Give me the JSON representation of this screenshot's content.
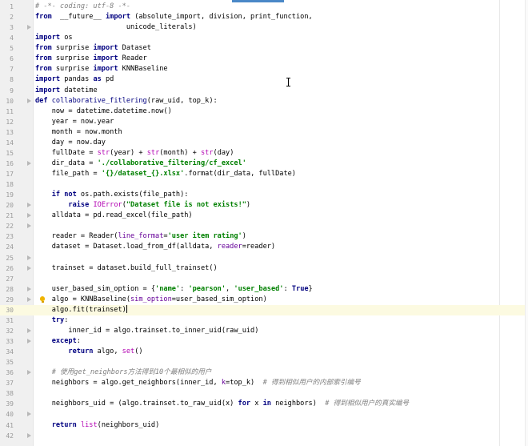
{
  "editor": {
    "language": "python",
    "current_line": 30,
    "lines": [
      {
        "n": "1",
        "t": [
          [
            "c",
            "# -*- coding: utf-8 -*-"
          ]
        ]
      },
      {
        "n": "2",
        "t": [
          [
            "k",
            "from"
          ],
          [
            "",
            "  __future__ "
          ],
          [
            "k",
            "import"
          ],
          [
            "",
            " (absolute_import, division, print_function,"
          ]
        ]
      },
      {
        "n": "3",
        "t": [
          [
            "",
            "                      unicode_literals)"
          ]
        ]
      },
      {
        "n": "4",
        "t": [
          [
            "k",
            "import"
          ],
          [
            "",
            " os"
          ]
        ]
      },
      {
        "n": "5",
        "t": [
          [
            "k",
            "from"
          ],
          [
            "",
            " surprise "
          ],
          [
            "k",
            "import"
          ],
          [
            "",
            " Dataset"
          ]
        ]
      },
      {
        "n": "6",
        "t": [
          [
            "k",
            "from"
          ],
          [
            "",
            " surprise "
          ],
          [
            "k",
            "import"
          ],
          [
            "",
            " Reader"
          ]
        ]
      },
      {
        "n": "7",
        "t": [
          [
            "k",
            "from"
          ],
          [
            "",
            " surprise "
          ],
          [
            "k",
            "import"
          ],
          [
            "",
            " KNNBaseline"
          ]
        ]
      },
      {
        "n": "8",
        "t": [
          [
            "k",
            "import"
          ],
          [
            "",
            " pandas "
          ],
          [
            "k",
            "as"
          ],
          [
            "",
            " pd"
          ]
        ]
      },
      {
        "n": "9",
        "t": [
          [
            "k",
            "import"
          ],
          [
            "",
            " datetime"
          ]
        ]
      },
      {
        "n": "10",
        "t": [
          [
            "k",
            "def"
          ],
          [
            "",
            " "
          ],
          [
            "f",
            "collaborative_fitlering"
          ],
          [
            "",
            "(raw_uid, top_k):"
          ]
        ]
      },
      {
        "n": "11",
        "t": [
          [
            "",
            "    now = datetime.datetime.now()"
          ]
        ]
      },
      {
        "n": "12",
        "t": [
          [
            "",
            "    year = now.year"
          ]
        ]
      },
      {
        "n": "13",
        "t": [
          [
            "",
            "    month = now.month"
          ]
        ]
      },
      {
        "n": "14",
        "t": [
          [
            "",
            "    day = now.day"
          ]
        ]
      },
      {
        "n": "15",
        "t": [
          [
            "",
            "    fullDate = "
          ],
          [
            "d",
            "str"
          ],
          [
            "",
            "(year) + "
          ],
          [
            "d",
            "str"
          ],
          [
            "",
            "(month) + "
          ],
          [
            "d",
            "str"
          ],
          [
            "",
            "(day)"
          ]
        ]
      },
      {
        "n": "16",
        "t": [
          [
            "",
            "    dir_data = "
          ],
          [
            "s",
            "'./collaborative_filtering/cf_excel'"
          ]
        ]
      },
      {
        "n": "17",
        "t": [
          [
            "",
            "    file_path = "
          ],
          [
            "s",
            "'{}/dataset_{}.xlsx'"
          ],
          [
            "",
            ".format(dir_data, fullDate)"
          ]
        ]
      },
      {
        "n": "18",
        "t": []
      },
      {
        "n": "19",
        "t": [
          [
            "",
            "    "
          ],
          [
            "k",
            "if not"
          ],
          [
            "",
            " os.path.exists(file_path):"
          ]
        ]
      },
      {
        "n": "20",
        "t": [
          [
            "",
            "        "
          ],
          [
            "k",
            "raise"
          ],
          [
            "",
            " "
          ],
          [
            "d",
            "IOError"
          ],
          [
            "",
            "("
          ],
          [
            "s",
            "\"Dataset file is not exists!\""
          ],
          [
            "",
            ")"
          ]
        ]
      },
      {
        "n": "21",
        "t": [
          [
            "",
            "    alldata = pd.read_excel(file_path)"
          ]
        ]
      },
      {
        "n": "22",
        "t": []
      },
      {
        "n": "23",
        "t": [
          [
            "",
            "    reader = Reader("
          ],
          [
            "p",
            "line_format"
          ],
          [
            "",
            "="
          ],
          [
            "s",
            "'user item rating'"
          ],
          [
            "",
            ")"
          ]
        ]
      },
      {
        "n": "24",
        "t": [
          [
            "",
            "    dataset = Dataset.load_from_df(alldata, "
          ],
          [
            "p",
            "reader"
          ],
          [
            "",
            "=reader)"
          ]
        ]
      },
      {
        "n": "25",
        "t": []
      },
      {
        "n": "26",
        "t": [
          [
            "",
            "    trainset = dataset.build_full_trainset()"
          ]
        ]
      },
      {
        "n": "27",
        "t": []
      },
      {
        "n": "28",
        "t": [
          [
            "",
            "    user_based_sim_option = {"
          ],
          [
            "s",
            "'name'"
          ],
          [
            "",
            ": "
          ],
          [
            "s",
            "'pearson'"
          ],
          [
            "",
            ", "
          ],
          [
            "s",
            "'user_based'"
          ],
          [
            "",
            ": "
          ],
          [
            "k",
            "True"
          ],
          [
            "",
            "}"
          ]
        ]
      },
      {
        "n": "29",
        "t": [
          [
            "",
            "    algo = KNNBaseline("
          ],
          [
            "p",
            "sim_option"
          ],
          [
            "",
            "=user_based_sim_option)"
          ]
        ]
      },
      {
        "n": "30",
        "t": [
          [
            "",
            "    algo.fit(trainset)"
          ]
        ]
      },
      {
        "n": "31",
        "t": [
          [
            "",
            "    "
          ],
          [
            "k",
            "try"
          ],
          [
            "",
            ":"
          ]
        ]
      },
      {
        "n": "32",
        "t": [
          [
            "",
            "        inner_id = algo.trainset.to_inner_uid(raw_uid)"
          ]
        ]
      },
      {
        "n": "33",
        "t": [
          [
            "",
            "    "
          ],
          [
            "k",
            "except"
          ],
          [
            "",
            ":"
          ]
        ]
      },
      {
        "n": "34",
        "t": [
          [
            "",
            "        "
          ],
          [
            "k",
            "return"
          ],
          [
            "",
            " algo, "
          ],
          [
            "d",
            "set"
          ],
          [
            "",
            "()"
          ]
        ]
      },
      {
        "n": "35",
        "t": []
      },
      {
        "n": "36",
        "t": [
          [
            "",
            "    "
          ],
          [
            "c",
            "# 使用get_neighbors方法得到10个最相似的用户"
          ]
        ]
      },
      {
        "n": "37",
        "t": [
          [
            "",
            "    neighbors = algo.get_neighbors(inner_id, "
          ],
          [
            "p",
            "k"
          ],
          [
            "",
            "=top_k)  "
          ],
          [
            "c",
            "# 得到相似用户的内部索引编号"
          ]
        ]
      },
      {
        "n": "38",
        "t": []
      },
      {
        "n": "39",
        "t": [
          [
            "",
            "    neighbors_uid = (algo.trainset.to_raw_uid(x) "
          ],
          [
            "k",
            "for"
          ],
          [
            "",
            " x "
          ],
          [
            "k",
            "in"
          ],
          [
            "",
            " neighbors)  "
          ],
          [
            "c",
            "# 得到相似用户的真实编号"
          ]
        ]
      },
      {
        "n": "40",
        "t": []
      },
      {
        "n": "41",
        "t": [
          [
            "",
            "    "
          ],
          [
            "k",
            "return"
          ],
          [
            "",
            " "
          ],
          [
            "d",
            "list"
          ],
          [
            "",
            "(neighbors_uid)"
          ]
        ]
      },
      {
        "n": "42",
        "t": []
      }
    ],
    "fold_markers_on": [
      "3",
      "10",
      "16",
      "20",
      "21",
      "22",
      "25",
      "26",
      "28",
      "29",
      "32",
      "33",
      "36",
      "40",
      "42"
    ],
    "intention_bulb_line": "29"
  },
  "colors": {
    "keyword": "#000080",
    "string": "#008000",
    "comment": "#808080",
    "param": "#660099",
    "builtin": "#b200b2",
    "current_line": "#fcfae1",
    "gutter": "#f0f0f0"
  }
}
